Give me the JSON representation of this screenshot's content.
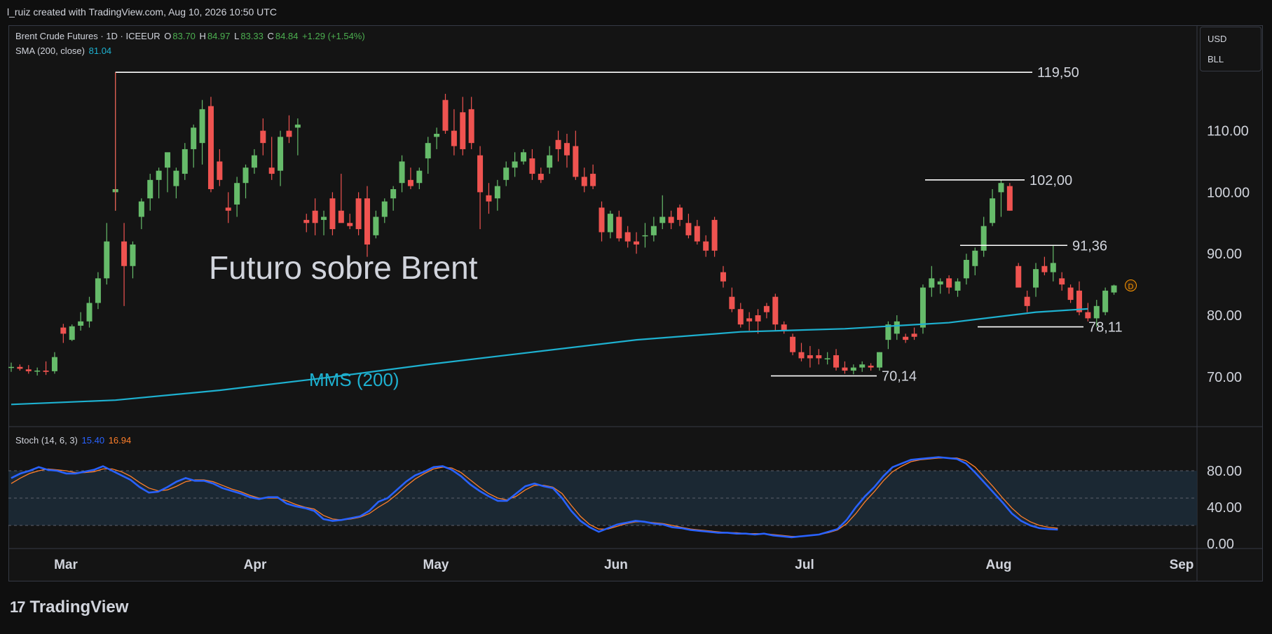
{
  "header": {
    "credit": "l_ruiz created with TradingView.com, Aug 10, 2026 10:50 UTC"
  },
  "legend": {
    "symbol": "Brent Crude Futures · 1D · ICEEUR",
    "o_label": "O",
    "o_value": "83.70",
    "h_label": "H",
    "h_value": "84.97",
    "l_label": "L",
    "l_value": "83.33",
    "c_label": "C",
    "c_value": "84.84",
    "change": "+1.29 (+1.54%)",
    "sma_label": "SMA (200, close)",
    "sma_value": "81.04"
  },
  "stoch_legend": {
    "label": "Stoch (14, 6, 3)",
    "k_value": "15.40",
    "d_value": "16.94"
  },
  "currency_badge": {
    "currency": "USD",
    "unit": "BLL"
  },
  "flag": {
    "label": "D"
  },
  "annotations": {
    "title": "Futuro sobre Brent",
    "sma_name": "MMS (200)",
    "levels": [
      "119,50",
      "102,00",
      "91,36",
      "78,11",
      "70,14"
    ]
  },
  "price_axis": [
    "110.00",
    "100.00",
    "90.00",
    "80.00",
    "70.00"
  ],
  "stoch_axis": [
    "80.00",
    "40.00",
    "0.00"
  ],
  "time_axis": [
    "Mar",
    "Apr",
    "May",
    "Jun",
    "Jul",
    "Aug",
    "Sep"
  ],
  "brand": {
    "name": "TradingView",
    "mark": "17"
  },
  "colors": {
    "up": "#66bb6a",
    "down": "#ef5350",
    "sma": "#1eb1d0",
    "stoch_k": "#2962ff",
    "stoch_d": "#ff7f2a",
    "level_line": "#ffffff",
    "stoch_band": "#1c2a36"
  },
  "chart_data": [
    {
      "type": "candlestick",
      "title": "Brent Crude Futures · 1D · ICEEUR",
      "x_labels": [
        "Mar",
        "Apr",
        "May",
        "Jun",
        "Jul",
        "Aug",
        "Sep"
      ],
      "ylim": [
        64,
        120.5
      ],
      "y_ticks": [
        70,
        80,
        90,
        100,
        110
      ],
      "candles_ohlc": [
        [
          71.5,
          72.3,
          70.8,
          71.6
        ],
        [
          71.6,
          72.0,
          71.0,
          71.3
        ],
        [
          71.2,
          71.9,
          70.5,
          70.9
        ],
        [
          70.9,
          71.5,
          70.2,
          71.0
        ],
        [
          71.0,
          72.5,
          70.3,
          70.8
        ],
        [
          70.9,
          74.0,
          70.5,
          73.2
        ],
        [
          78.0,
          78.6,
          75.5,
          77.0
        ],
        [
          76.0,
          78.5,
          75.8,
          78.2
        ],
        [
          78.3,
          80.5,
          77.5,
          79.0
        ],
        [
          79.0,
          83.0,
          78.0,
          82.0
        ],
        [
          82.0,
          87.0,
          81.0,
          86.0
        ],
        [
          86.0,
          95.0,
          85.0,
          92.0
        ],
        [
          100.0,
          119.5,
          97.0,
          100.5
        ],
        [
          92.0,
          95.0,
          81.5,
          88.0
        ],
        [
          88.0,
          92.0,
          86.0,
          91.5
        ],
        [
          96.0,
          99.0,
          94.0,
          98.5
        ],
        [
          99.0,
          103.0,
          97.0,
          102.0
        ],
        [
          102.0,
          104.0,
          99.0,
          103.5
        ],
        [
          104.0,
          106.0,
          100.0,
          106.5
        ],
        [
          101.0,
          104.0,
          99.0,
          103.5
        ],
        [
          103.0,
          108.0,
          102.0,
          107.0
        ],
        [
          107.0,
          111.0,
          104.0,
          110.5
        ],
        [
          108.0,
          115.0,
          104.5,
          113.5
        ],
        [
          114.0,
          115.5,
          100.0,
          100.5
        ],
        [
          105.0,
          107.0,
          101.0,
          102.0
        ],
        [
          97.5,
          100.0,
          95.0,
          97.0
        ],
        [
          98.0,
          102.5,
          96.0,
          101.5
        ],
        [
          101.5,
          104.5,
          99.0,
          104.0
        ],
        [
          104.0,
          107.0,
          103.0,
          106.0
        ],
        [
          110.0,
          112.0,
          106.0,
          108.0
        ],
        [
          104.0,
          109.0,
          102.0,
          103.0
        ],
        [
          103.5,
          110.0,
          101.0,
          109.0
        ],
        [
          110.0,
          112.5,
          108.0,
          109.0
        ],
        [
          110.5,
          112.0,
          106.0,
          111.0
        ],
        [
          95.5,
          96.5,
          93.5,
          95.0
        ],
        [
          97.0,
          99.0,
          93.0,
          95.0
        ],
        [
          95.5,
          97.0,
          93.0,
          96.0
        ],
        [
          99.0,
          100.0,
          93.0,
          94.0
        ],
        [
          97.0,
          103.0,
          96.0,
          95.0
        ],
        [
          95.0,
          96.5,
          94.0,
          94.5
        ],
        [
          99.0,
          100.0,
          93.0,
          94.0
        ],
        [
          99.0,
          101.0,
          89.5,
          91.5
        ],
        [
          93.0,
          97.0,
          92.5,
          96.0
        ],
        [
          96.0,
          99.0,
          95.0,
          98.5
        ],
        [
          99.0,
          101.0,
          97.0,
          100.5
        ],
        [
          101.5,
          106.0,
          100.0,
          105.0
        ],
        [
          102.0,
          104.0,
          100.5,
          101.0
        ],
        [
          101.5,
          104.0,
          100.5,
          103.5
        ],
        [
          105.5,
          109.0,
          103.0,
          108.0
        ],
        [
          109.0,
          110.5,
          107.0,
          109.5
        ],
        [
          115.0,
          116.0,
          109.5,
          110.0
        ],
        [
          110.0,
          113.5,
          106.0,
          107.5
        ],
        [
          113.0,
          115.5,
          106.0,
          107.0
        ],
        [
          113.5,
          115.5,
          107.0,
          108.0
        ],
        [
          106.0,
          107.5,
          94.0,
          100.0
        ],
        [
          99.5,
          101.5,
          96.5,
          98.5
        ],
        [
          99.0,
          102.0,
          97.0,
          101.0
        ],
        [
          102.0,
          105.0,
          101.0,
          104.0
        ],
        [
          104.0,
          106.5,
          102.5,
          105.0
        ],
        [
          105.0,
          107.0,
          104.5,
          106.5
        ],
        [
          105.5,
          107.0,
          102.0,
          103.0
        ],
        [
          103.0,
          104.0,
          101.5,
          102.0
        ],
        [
          104.0,
          107.5,
          103.0,
          106.0
        ],
        [
          108.5,
          110.0,
          105.0,
          107.0
        ],
        [
          108.0,
          109.5,
          104.0,
          106.0
        ],
        [
          107.5,
          110.0,
          102.0,
          102.5
        ],
        [
          102.5,
          104.0,
          100.0,
          101.0
        ],
        [
          103.0,
          104.5,
          100.5,
          101.0
        ],
        [
          97.5,
          98.5,
          92.0,
          93.5
        ],
        [
          93.5,
          97.0,
          92.5,
          96.5
        ],
        [
          96.0,
          97.0,
          92.0,
          92.5
        ],
        [
          93.5,
          94.5,
          91.0,
          92.0
        ],
        [
          92.0,
          93.5,
          90.0,
          91.5
        ],
        [
          93.0,
          95.0,
          91.0,
          93.0
        ],
        [
          93.0,
          96.0,
          92.0,
          94.5
        ],
        [
          95.0,
          99.5,
          94.0,
          96.0
        ],
        [
          96.0,
          97.0,
          94.0,
          95.0
        ],
        [
          97.5,
          98.0,
          94.5,
          95.5
        ],
        [
          95.0,
          96.5,
          92.5,
          93.0
        ],
        [
          94.5,
          95.5,
          91.5,
          92.0
        ],
        [
          92.0,
          93.0,
          89.5,
          90.5
        ],
        [
          95.5,
          96.0,
          89.5,
          90.5
        ],
        [
          87.0,
          88.0,
          84.5,
          85.5
        ],
        [
          83.0,
          84.5,
          80.5,
          81.0
        ],
        [
          81.0,
          82.0,
          78.0,
          78.5
        ],
        [
          79.5,
          80.5,
          77.5,
          79.0
        ],
        [
          80.0,
          81.0,
          77.0,
          79.0
        ],
        [
          81.5,
          82.0,
          79.5,
          80.5
        ],
        [
          83.0,
          83.5,
          77.5,
          78.5
        ],
        [
          78.5,
          79.0,
          77.0,
          77.5
        ],
        [
          76.5,
          77.0,
          73.5,
          74.0
        ],
        [
          74.0,
          75.5,
          72.5,
          73.0
        ],
        [
          73.5,
          75.0,
          71.5,
          73.0
        ],
        [
          73.5,
          74.5,
          72.0,
          73.0
        ],
        [
          73.0,
          74.0,
          72.0,
          73.0
        ],
        [
          73.5,
          74.5,
          71.0,
          71.5
        ],
        [
          71.5,
          72.5,
          70.5,
          71.0
        ],
        [
          71.0,
          72.0,
          70.4,
          71.5
        ],
        [
          71.5,
          72.5,
          70.8,
          72.0
        ],
        [
          71.8,
          72.2,
          71.0,
          71.5
        ],
        [
          71.5,
          74.0,
          71.0,
          74.0
        ],
        [
          76.0,
          79.0,
          74.5,
          78.5
        ],
        [
          77.0,
          80.0,
          76.0,
          79.0
        ],
        [
          76.5,
          77.0,
          75.5,
          76.0
        ],
        [
          77.0,
          78.0,
          76.0,
          76.5
        ],
        [
          78.0,
          85.0,
          77.0,
          84.5
        ],
        [
          84.5,
          88.0,
          83.0,
          86.0
        ],
        [
          85.0,
          86.0,
          83.5,
          85.5
        ],
        [
          86.0,
          86.5,
          83.5,
          84.5
        ],
        [
          84.0,
          86.0,
          83.0,
          85.5
        ],
        [
          86.0,
          90.0,
          85.0,
          89.0
        ],
        [
          88.0,
          91.0,
          86.5,
          90.5
        ],
        [
          90.5,
          96.0,
          89.5,
          94.5
        ],
        [
          95.0,
          100.5,
          94.5,
          99.0
        ],
        [
          100.0,
          102.0,
          96.0,
          101.5
        ],
        [
          101.0,
          101.5,
          97.0,
          97.0
        ],
        [
          88.0,
          88.5,
          84.5,
          84.5
        ],
        [
          83.0,
          84.0,
          80.5,
          81.5
        ],
        [
          84.5,
          88.5,
          83.0,
          87.5
        ],
        [
          88.0,
          89.5,
          86.5,
          87.0
        ],
        [
          87.0,
          91.36,
          85.5,
          88.5
        ],
        [
          86.0,
          87.0,
          84.0,
          85.0
        ],
        [
          84.5,
          85.0,
          82.0,
          82.5
        ],
        [
          84.0,
          85.5,
          80.0,
          80.5
        ],
        [
          80.5,
          82.0,
          79.0,
          79.5
        ],
        [
          79.5,
          82.5,
          78.11,
          81.5
        ],
        [
          80.5,
          84.5,
          80.0,
          84.0
        ],
        [
          83.7,
          84.97,
          83.33,
          84.84
        ]
      ],
      "sma": {
        "name": "MMS (200)",
        "x_index": [
          0,
          12,
          24,
          36,
          48,
          60,
          72,
          84,
          96,
          108,
          118,
          124
        ],
        "values": [
          65.5,
          66.2,
          67.8,
          69.8,
          72.0,
          74.0,
          76.0,
          77.3,
          77.8,
          78.8,
          80.5,
          81.04
        ]
      }
    },
    {
      "type": "line",
      "title": "Stoch (14, 6, 3)",
      "ylim": [
        0,
        100
      ],
      "y_ticks": [
        0,
        40,
        80
      ],
      "series": [
        {
          "name": "%K",
          "values": [
            72,
            77,
            80,
            84,
            81,
            80,
            77,
            77,
            79,
            81,
            85,
            80,
            75,
            70,
            62,
            56,
            57,
            62,
            68,
            72,
            69,
            69,
            66,
            61,
            58,
            55,
            51,
            49,
            51,
            51,
            44,
            41,
            39,
            36,
            27,
            25,
            26,
            28,
            30,
            36,
            46,
            50,
            59,
            68,
            75,
            79,
            84,
            85,
            81,
            74,
            65,
            58,
            52,
            47,
            47,
            55,
            63,
            66,
            63,
            61,
            50,
            36,
            25,
            18,
            13,
            17,
            21,
            23,
            25,
            24,
            22,
            21,
            18,
            17,
            15,
            14,
            13,
            12,
            12,
            11,
            11,
            10,
            11,
            9,
            8,
            7,
            8,
            9,
            10,
            13,
            16,
            26,
            40,
            52,
            62,
            74,
            84,
            88,
            92,
            93,
            94,
            95,
            94,
            93,
            88,
            78,
            67,
            56,
            45,
            33,
            25,
            20,
            17,
            16,
            15.4
          ]
        },
        {
          "name": "%D",
          "values": [
            66,
            72,
            77,
            80,
            82,
            81,
            80,
            78,
            78,
            79,
            82,
            82,
            79,
            74,
            67,
            61,
            58,
            59,
            63,
            68,
            70,
            70,
            68,
            64,
            60,
            57,
            53,
            50,
            50,
            50,
            47,
            43,
            40,
            38,
            31,
            27,
            26,
            27,
            29,
            33,
            40,
            46,
            54,
            63,
            71,
            77,
            82,
            84,
            83,
            78,
            70,
            62,
            55,
            50,
            48,
            52,
            59,
            64,
            64,
            62,
            55,
            42,
            30,
            21,
            16,
            16,
            19,
            22,
            24,
            24,
            23,
            22,
            20,
            18,
            16,
            15,
            14,
            13,
            12,
            12,
            11,
            11,
            11,
            10,
            9,
            8,
            8,
            9,
            10,
            12,
            15,
            22,
            33,
            46,
            57,
            69,
            79,
            85,
            90,
            92,
            93,
            94,
            94,
            94,
            91,
            84,
            73,
            62,
            50,
            39,
            30,
            24,
            20,
            18,
            16.94
          ]
        }
      ]
    }
  ]
}
